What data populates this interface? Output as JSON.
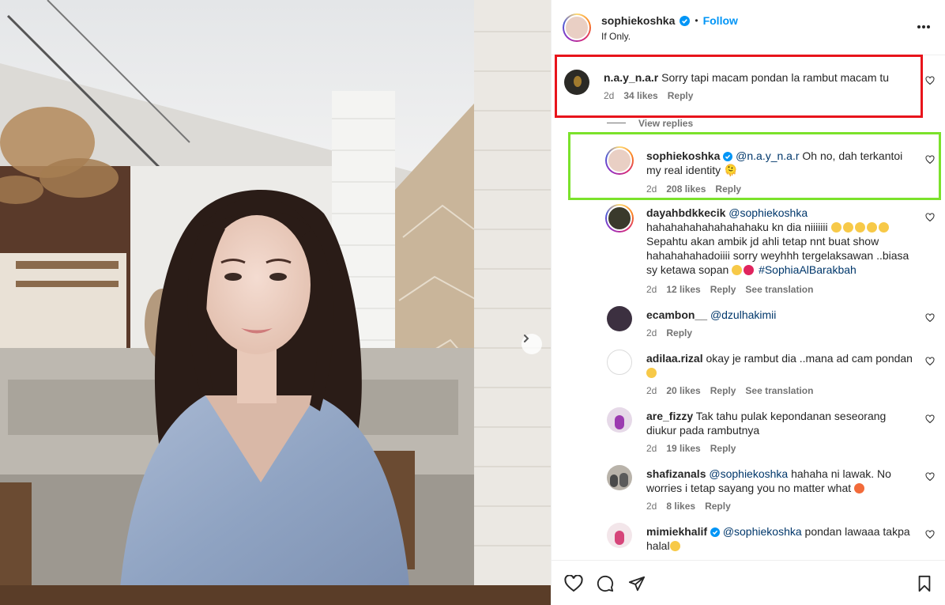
{
  "post": {
    "author": "sophiekoshka",
    "follow_label": "Follow",
    "dot": "•",
    "caption": "If Only."
  },
  "comments": [
    {
      "user": "n.a.y_n.a.r",
      "text": "Sorry tapi macam pondan la rambut macam tu",
      "age": "2d",
      "likes": "34 likes",
      "reply": "Reply",
      "view_replies": "View replies"
    },
    {
      "user": "sophiekoshka",
      "mention": "@n.a.y_n.a.r",
      "text_line1": " Oh no, dah terkantoi my",
      "text_line2": "real identity 🫠",
      "age": "2d",
      "likes": "208 likes",
      "reply": "Reply"
    },
    {
      "user": "dayahbdkkecik",
      "mention": "@sophiekoshka",
      "line2": "hahahahahahahahahaku kn dia niiiiiii",
      "line3": "Sepahtu akan ambik jd ahli tetap nnt buat show",
      "line4": "hahahahahadoiiii sorry weyhhh tergelaksawan ..biasa",
      "line5_prefix": "sy ketawa sopan ",
      "hashtag": "#SophiaAlBarakbah",
      "age": "2d",
      "likes": "12 likes",
      "reply": "Reply",
      "translate": "See translation"
    },
    {
      "user": "ecambon__",
      "mention": "@dzulhakimii",
      "age": "2d",
      "reply": "Reply"
    },
    {
      "user": "adilaa.rizal",
      "text": "okay je rambut dia ..mana ad cam pondan",
      "age": "2d",
      "likes": "20 likes",
      "reply": "Reply",
      "translate": "See translation"
    },
    {
      "user": "are_fizzy",
      "text_line1": "Tak tahu pulak kepondanan seseorang",
      "text_line2": "diukur pada rambutnya",
      "age": "2d",
      "likes": "19 likes",
      "reply": "Reply"
    },
    {
      "user": "shafizanals",
      "mention": "@sophiekoshka",
      "text_line1": " hahaha ni lawak. No",
      "text_line2": "worries i tetap sayang you no matter what",
      "age": "2d",
      "likes": "8 likes",
      "reply": "Reply"
    },
    {
      "user": "mimiekhalif",
      "mention": "@sophiekoshka",
      "text_line1": " pondan lawaaa takpa",
      "text_line2": "halal"
    }
  ],
  "colors": {
    "accent": "#0095f6",
    "highlight_red": "#e8141b",
    "highlight_green": "#7be22b"
  },
  "icons": [
    "heart-icon",
    "comment-icon",
    "share-icon",
    "bookmark-icon",
    "more-options-icon",
    "chevron-right-icon",
    "verified-badge-icon"
  ]
}
